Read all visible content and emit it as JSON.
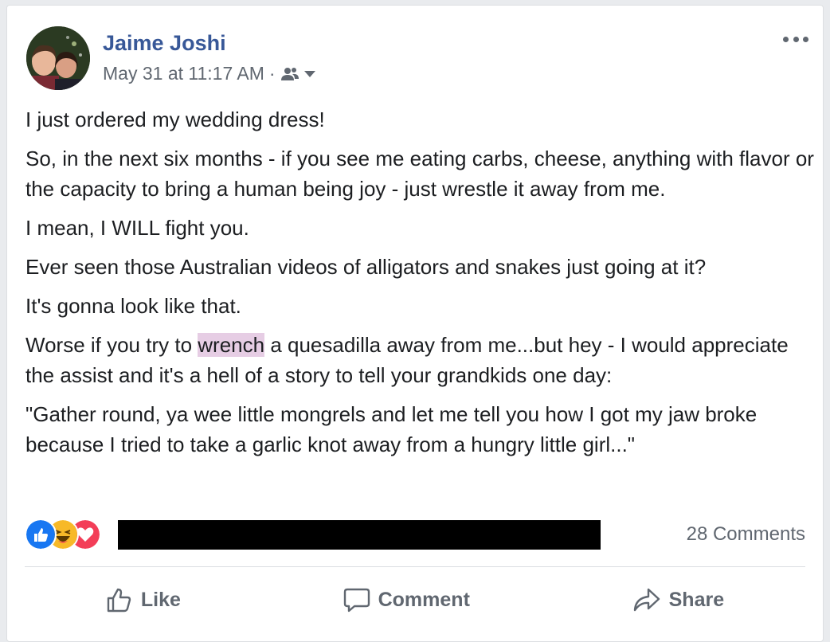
{
  "post": {
    "author": "Jaime Joshi",
    "timestamp": "May 31 at 11:17 AM",
    "separator": "·",
    "audience_icon": "friends-icon",
    "paragraphs": [
      "I just ordered my wedding dress!",
      "So, in the next six months - if you see me eating carbs, cheese, anything with flavor or the capacity to bring a human being joy - just wrestle it away from me.",
      "I mean, I WILL fight you.",
      "Ever seen those Australian videos of alligators and snakes just going at it?",
      "It's gonna look like that."
    ],
    "p6_before": "Worse if you try to ",
    "p6_highlight": "wrench",
    "p6_after": " a quesadilla away from me...but hey - I would appreciate the assist and it's a hell of a story to tell your grandkids one day:",
    "p7": "\"Gather round, ya wee little mongrels and let me tell you how I got my jaw broke because I tried to take a garlic knot away from a hungry little girl...\""
  },
  "footer": {
    "reaction_icons": [
      "like-reaction-icon",
      "haha-reaction-icon",
      "love-reaction-icon"
    ],
    "comments_count": "28 Comments"
  },
  "actions": {
    "like": "Like",
    "comment": "Comment",
    "share": "Share"
  },
  "colors": {
    "author_link": "#385898",
    "meta_text": "#606770",
    "highlight": "#e6cde4",
    "like_blue": "#1877f2",
    "love_red": "#f33e58",
    "haha_yellow": "#f7b928"
  }
}
